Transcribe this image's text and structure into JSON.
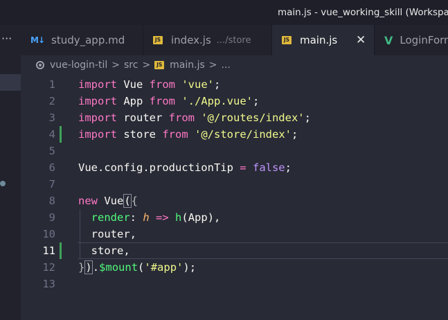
{
  "titlebar": {
    "title": "main.js - vue_working_skill (Workspace)"
  },
  "tabs": [
    {
      "icon": "markdown-icon",
      "icon_glyph": "M↓",
      "label": "study_app.md",
      "path": ""
    },
    {
      "icon": "js-file-icon",
      "icon_glyph": "JS",
      "label": "index.js",
      "path": ".../store"
    },
    {
      "icon": "js-file-icon",
      "icon_glyph": "JS",
      "label": "main.js",
      "path": "",
      "active": true
    },
    {
      "icon": "vue-file-icon",
      "icon_glyph": "V",
      "label": "LoginForm.vue",
      "path": ""
    }
  ],
  "tab_close_glyph": "✕",
  "more_glyph": "···",
  "breadcrumb": {
    "items": [
      "vue-login-til",
      "src",
      "main.js",
      "..."
    ],
    "separator": ">",
    "file_icon": "JS"
  },
  "editor": {
    "current_line": 11,
    "modified_lines": [
      4,
      11
    ],
    "lines": [
      {
        "n": "1",
        "tokens": [
          [
            "kw",
            "import"
          ],
          [
            "id",
            " Vue "
          ],
          [
            "kw",
            "from"
          ],
          [
            "id",
            " "
          ],
          [
            "str",
            "'vue'"
          ],
          [
            "id",
            ";"
          ]
        ]
      },
      {
        "n": "2",
        "tokens": [
          [
            "kw",
            "import"
          ],
          [
            "id",
            " App "
          ],
          [
            "kw",
            "from"
          ],
          [
            "id",
            " "
          ],
          [
            "str",
            "'./App.vue'"
          ],
          [
            "id",
            ";"
          ]
        ]
      },
      {
        "n": "3",
        "tokens": [
          [
            "kw",
            "import"
          ],
          [
            "id",
            " router "
          ],
          [
            "kw",
            "from"
          ],
          [
            "id",
            " "
          ],
          [
            "str",
            "'@/routes/index'"
          ],
          [
            "id",
            ";"
          ]
        ]
      },
      {
        "n": "4",
        "tokens": [
          [
            "kw",
            "import"
          ],
          [
            "id",
            " store "
          ],
          [
            "kw",
            "from"
          ],
          [
            "id",
            " "
          ],
          [
            "str",
            "'@/store/index'"
          ],
          [
            "id",
            ";"
          ]
        ]
      },
      {
        "n": "5",
        "tokens": []
      },
      {
        "n": "6",
        "tokens": [
          [
            "id",
            "Vue.config.productionTip "
          ],
          [
            "op",
            "="
          ],
          [
            "id",
            " "
          ],
          [
            "bool",
            "false"
          ],
          [
            "id",
            ";"
          ]
        ]
      },
      {
        "n": "7",
        "tokens": []
      },
      {
        "n": "8",
        "tokens": [
          [
            "kw",
            "new"
          ],
          [
            "id",
            " Vue"
          ],
          [
            "brm",
            "("
          ],
          [
            "br",
            "{"
          ]
        ]
      },
      {
        "n": "9",
        "tokens": [
          [
            "id",
            "  "
          ],
          [
            "fn",
            "render"
          ],
          [
            "id",
            ": "
          ],
          [
            "param",
            "h"
          ],
          [
            "id",
            " "
          ],
          [
            "op",
            "=>"
          ],
          [
            "id",
            " "
          ],
          [
            "fn",
            "h"
          ],
          [
            "id",
            "(App),"
          ]
        ]
      },
      {
        "n": "10",
        "tokens": [
          [
            "id",
            "  router,"
          ]
        ]
      },
      {
        "n": "11",
        "tokens": [
          [
            "id",
            "  store,"
          ]
        ]
      },
      {
        "n": "12",
        "tokens": [
          [
            "br",
            "}"
          ],
          [
            "brm",
            ")"
          ],
          [
            "id",
            "."
          ],
          [
            "fn",
            "$mount"
          ],
          [
            "id",
            "("
          ],
          [
            "str",
            "'#app'"
          ],
          [
            "id",
            ");"
          ]
        ]
      },
      {
        "n": "13",
        "tokens": []
      }
    ]
  },
  "colors": {
    "background": "#282a36",
    "keyword": "#ff79c6",
    "string": "#f1fa8c",
    "function": "#50fa7b",
    "boolean": "#bd93f9",
    "parameter": "#ffb86c",
    "modified_marker": "#3fa35b"
  }
}
